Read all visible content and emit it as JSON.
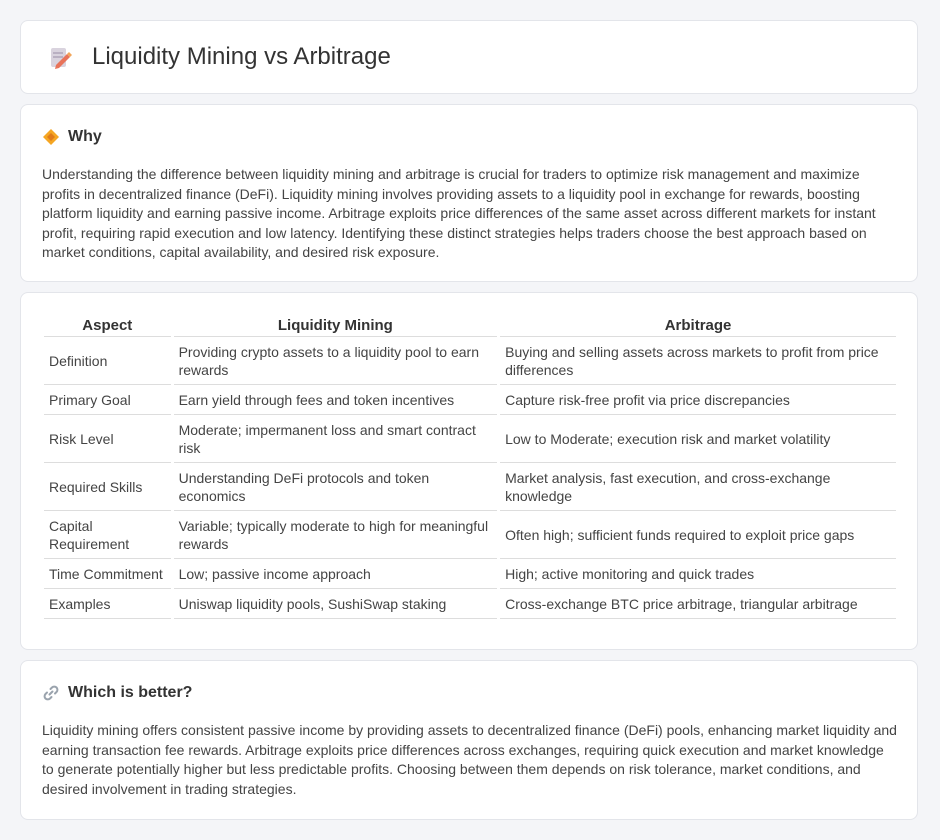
{
  "header": {
    "title": "Liquidity Mining vs Arbitrage",
    "icon": "document-pencil-icon"
  },
  "why": {
    "title": "Why",
    "icon": "diamond-icon",
    "text": "Understanding the difference between liquidity mining and arbitrage is crucial for traders to optimize risk management and maximize profits in decentralized finance (DeFi). Liquidity mining involves providing assets to a liquidity pool in exchange for rewards, boosting platform liquidity and earning passive income. Arbitrage exploits price differences of the same asset across different markets for instant profit, requiring rapid execution and low latency. Identifying these distinct strategies helps traders choose the best approach based on market conditions, capital availability, and desired risk exposure."
  },
  "table": {
    "headers": [
      "Aspect",
      "Liquidity Mining",
      "Arbitrage"
    ],
    "rows": [
      [
        "Definition",
        "Providing crypto assets to a liquidity pool to earn rewards",
        "Buying and selling assets across markets to profit from price differences"
      ],
      [
        "Primary Goal",
        "Earn yield through fees and token incentives",
        "Capture risk-free profit via price discrepancies"
      ],
      [
        "Risk Level",
        "Moderate; impermanent loss and smart contract risk",
        "Low to Moderate; execution risk and market volatility"
      ],
      [
        "Required Skills",
        "Understanding DeFi protocols and token economics",
        "Market analysis, fast execution, and cross-exchange knowledge"
      ],
      [
        "Capital Requirement",
        "Variable; typically moderate to high for meaningful rewards",
        "Often high; sufficient funds required to exploit price gaps"
      ],
      [
        "Time Commitment",
        "Low; passive income approach",
        "High; active monitoring and quick trades"
      ],
      [
        "Examples",
        "Uniswap liquidity pools, SushiSwap staking",
        "Cross-exchange BTC price arbitrage, triangular arbitrage"
      ]
    ]
  },
  "better": {
    "title": "Which is better?",
    "icon": "link-icon",
    "text": "Liquidity mining offers consistent passive income by providing assets to decentralized finance (DeFi) pools, enhancing market liquidity and earning transaction fee rewards. Arbitrage exploits price differences across exchanges, requiring quick execution and market knowledge to generate potentially higher but less predictable profits. Choosing between them depends on risk tolerance, market conditions, and desired involvement in trading strategies."
  }
}
